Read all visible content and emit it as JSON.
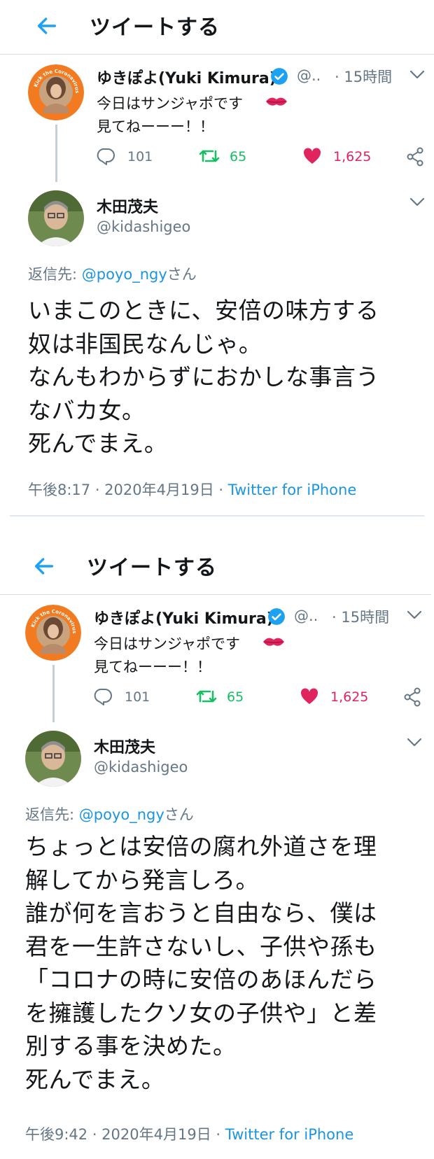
{
  "colors": {
    "accent": "#1da1f2",
    "retweet": "#17bf63",
    "like": "#e0245e",
    "muted": "#657786"
  },
  "screens": [
    {
      "header": {
        "title": "ツイートする",
        "back_icon": "arrow-left-icon"
      },
      "original": {
        "name": "ゆきぽよ(Yuki Kimura)",
        "handle": "@..",
        "time": "· 15時間",
        "line1": "今日はサンジャポです",
        "line2": "見てねーーー！！",
        "avatar_text": "Kick the Coronavirus · Wash hands and gargle",
        "reply_count": "101",
        "retweet_count": "65",
        "like_count": "1,625"
      },
      "reply": {
        "name": "木田茂夫",
        "handle": "@kidashigeo",
        "reply_to_prefix": "返信先: ",
        "reply_to_mention": "@poyo_ngy",
        "reply_to_suffix": "さん",
        "lines": [
          "いまこのときに、安倍の味方する",
          "奴は非国民なんじゃ。",
          "なんもわからずにおかしな事言う",
          "なバカ女。",
          "死んでまえ。"
        ],
        "timestamp": "午後8:17 · 2020年4月19日 · ",
        "client": "Twitter for iPhone"
      }
    },
    {
      "header": {
        "title": "ツイートする",
        "back_icon": "arrow-left-icon"
      },
      "original": {
        "name": "ゆきぽよ(Yuki Kimura)",
        "handle": "@..",
        "time": "· 15時間",
        "line1": "今日はサンジャポです",
        "line2": "見てねーーー！！",
        "avatar_text": "Kick the Coronavirus · Wash hands and gargle",
        "reply_count": "101",
        "retweet_count": "65",
        "like_count": "1,625"
      },
      "reply": {
        "name": "木田茂夫",
        "handle": "@kidashigeo",
        "reply_to_prefix": "返信先: ",
        "reply_to_mention": "@poyo_ngy",
        "reply_to_suffix": "さん",
        "lines": [
          "ちょっとは安倍の腐れ外道さを理",
          "解してから発言しろ。",
          "誰が何を言おうと自由なら、僕は",
          "君を一生許さないし、子供や孫も",
          "「コロナの時に安倍のあほんだら",
          "を擁護したクソ女の子供や」と差",
          "別する事を決めた。",
          "死んでまえ。"
        ],
        "timestamp": "午後9:42 · 2020年4月19日 · ",
        "client": "Twitter for iPhone"
      }
    }
  ]
}
